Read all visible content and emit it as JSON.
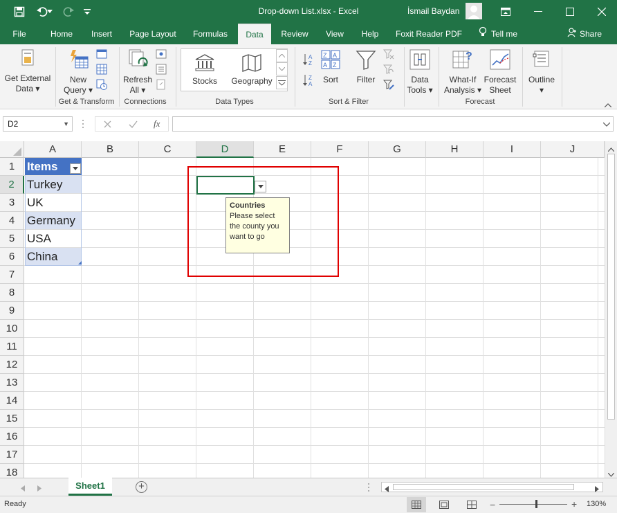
{
  "window": {
    "title": "Drop-down List.xlsx  -  Excel",
    "user": "İsmail Baydan"
  },
  "tabs": [
    {
      "label": "File"
    },
    {
      "label": "Home"
    },
    {
      "label": "Insert"
    },
    {
      "label": "Page Layout"
    },
    {
      "label": "Formulas"
    },
    {
      "label": "Data"
    },
    {
      "label": "Review"
    },
    {
      "label": "View"
    },
    {
      "label": "Help"
    },
    {
      "label": "Foxit Reader PDF"
    }
  ],
  "tell_me": "Tell me",
  "share": "Share",
  "ribbon": {
    "get_external_data": {
      "line1": "Get External",
      "line2": "Data ▾"
    },
    "new_query": {
      "line1": "New",
      "line2": "Query ▾"
    },
    "get_transform_label": "Get & Transform",
    "refresh_all": {
      "line1": "Refresh",
      "line2": "All ▾"
    },
    "connections_label": "Connections",
    "stocks": "Stocks",
    "geography": "Geography",
    "data_types_label": "Data Types",
    "sort": "Sort",
    "filter": "Filter",
    "sort_filter_label": "Sort & Filter",
    "data_tools": {
      "line1": "Data",
      "line2": "Tools ▾"
    },
    "what_if": {
      "line1": "What-If",
      "line2": "Analysis ▾"
    },
    "forecast_sheet": {
      "line1": "Forecast",
      "line2": "Sheet"
    },
    "forecast_label": "Forecast",
    "outline": {
      "line1": "Outline",
      "line2": "▾"
    }
  },
  "formula_bar": {
    "name_box": "D2",
    "fx": "fx",
    "formula": ""
  },
  "columns": [
    "A",
    "B",
    "C",
    "D",
    "E",
    "F",
    "G",
    "H",
    "I",
    "J"
  ],
  "rows": [
    "1",
    "2",
    "3",
    "4",
    "5",
    "6",
    "7",
    "8",
    "9",
    "10",
    "11",
    "12",
    "13",
    "14",
    "15",
    "16",
    "17",
    "18"
  ],
  "table": {
    "header": "Items",
    "items": [
      "Turkey",
      "UK",
      "Germany",
      "USA",
      "China"
    ]
  },
  "input_message": {
    "title": "Countries",
    "body": "Please select the county you want to go"
  },
  "sheets": [
    {
      "name": "Sheet1"
    }
  ],
  "status": {
    "text": "Ready",
    "zoom": "130%"
  },
  "colors": {
    "accent": "#217346",
    "table_header": "#4472c4",
    "table_band": "#d9e1f2",
    "highlight_box": "#e00000"
  }
}
